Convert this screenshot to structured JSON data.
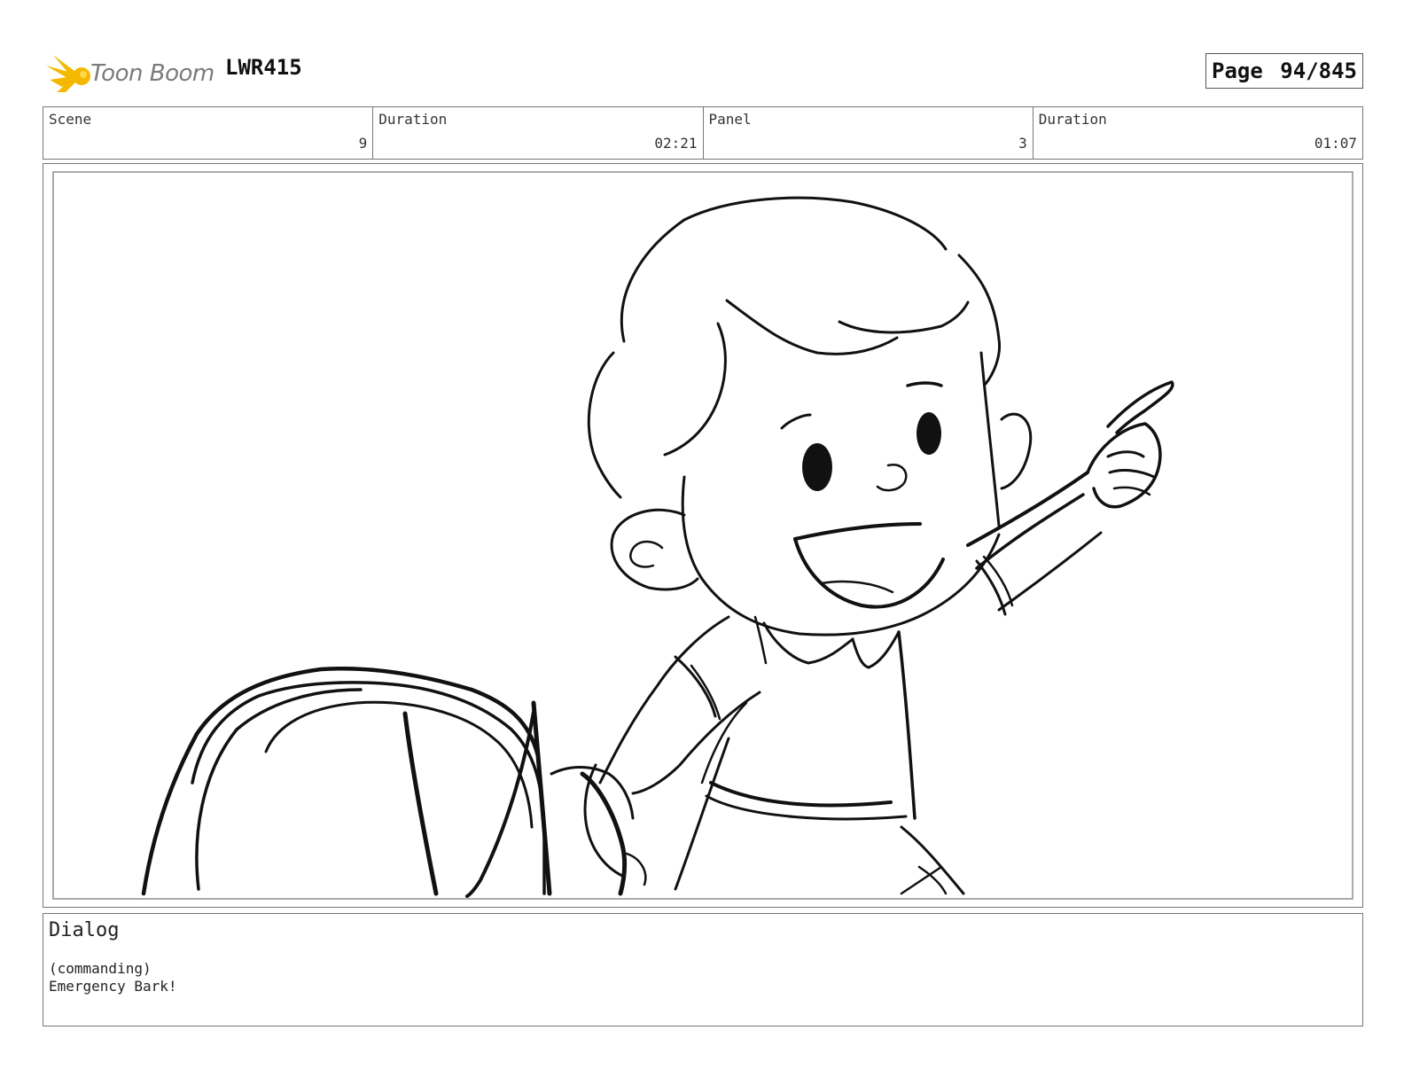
{
  "header": {
    "logo_text": "Toon Boom",
    "project": "LWR415",
    "page_label": "Page",
    "page_value": "94/845"
  },
  "info": [
    {
      "label": "Scene",
      "value": "9"
    },
    {
      "label": "Duration",
      "value": "02:21"
    },
    {
      "label": "Panel",
      "value": "3"
    },
    {
      "label": "Duration",
      "value": "01:07"
    }
  ],
  "dialog": {
    "title": "Dialog",
    "lines": [
      "(commanding)",
      "Emergency Bark!"
    ]
  },
  "colors": {
    "logo_accent": "#f5b800",
    "sketch_ink": "#111111"
  }
}
